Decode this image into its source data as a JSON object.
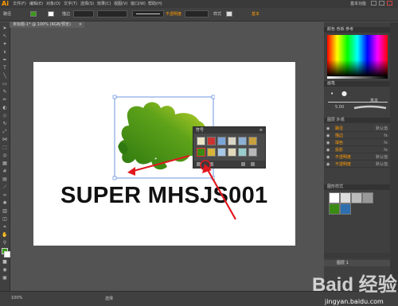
{
  "menubar": {
    "logo": "Ai",
    "items": [
      "文件(F)",
      "编辑(E)",
      "对象(O)",
      "文字(T)",
      "选择(S)",
      "效果(C)",
      "视图(V)",
      "窗口(W)",
      "帮助(H)"
    ],
    "workspace": "基本功能"
  },
  "controlbar": {
    "label": "路径",
    "stroke_label": "描边",
    "stroke_value": "",
    "uniform_label": "等比",
    "basic_label": "基本",
    "opacity_label": "不透明度",
    "style_label": "样式"
  },
  "document": {
    "tab_title": "未标题-1* @ 100% (RGB/预览)",
    "close": "×"
  },
  "artwork": {
    "slogan": "SUPER MHSJS001"
  },
  "symbols_panel": {
    "title": "符号",
    "menu": "≡"
  },
  "right_panels": {
    "color_title": "颜色 色板 参考",
    "brush_title": "画笔",
    "brush_value": "5.00",
    "brush_label": "基本",
    "layers_title": "图层 外观",
    "layers": [
      {
        "name": "路径",
        "label": "默认值"
      },
      {
        "name": "描边",
        "label": "fx"
      },
      {
        "name": "填色",
        "label": "fx"
      },
      {
        "name": "投影",
        "label": "fx"
      },
      {
        "name": "不透明度",
        "label": "默认值"
      },
      {
        "name": "不透明度",
        "label": "默认值"
      }
    ],
    "graphic_styles_title": "图形样式",
    "layer_name": "图层 1"
  },
  "statusbar": {
    "zoom": "100%",
    "mode": "选择",
    "site": "jingyan.baidu.com"
  },
  "watermark": "Baid 经验",
  "colors": {
    "accent": "#ff9a00",
    "leaf_dark": "#2f7a10",
    "leaf_light": "#a4cc1a",
    "arrow": "#e0191f",
    "selection": "#4a7bd8"
  }
}
